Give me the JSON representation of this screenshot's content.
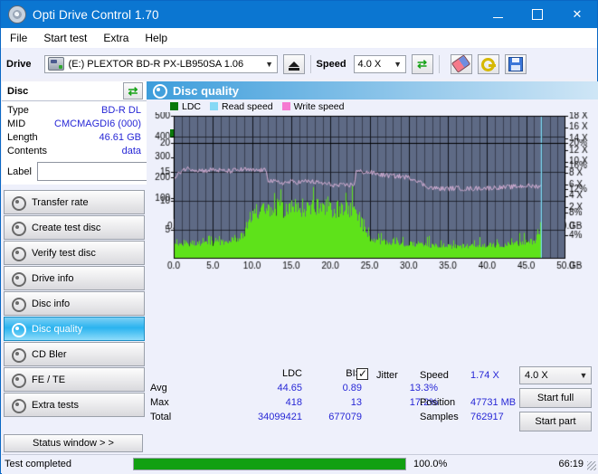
{
  "window": {
    "title": "Opti Drive Control 1.70",
    "icon": "disc-icon",
    "minimize": "–",
    "maximize": "□",
    "close": "✕"
  },
  "menu": {
    "items": [
      "File",
      "Start test",
      "Extra",
      "Help"
    ]
  },
  "drivebar": {
    "drive_label": "Drive",
    "drive_value": "(E:)   PLEXTOR BD-R  PX-LB950SA 1.06",
    "eject_icon": "eject-icon",
    "speed_label": "Speed",
    "speed_value": "4.0 X",
    "refresh_icon": "refresh-icon",
    "erase_icon": "eraser-icon",
    "key_icon": "key-icon",
    "save_icon": "floppy-save-icon"
  },
  "disc": {
    "header": "Disc",
    "refresh_icon": "refresh-icon",
    "fields": [
      {
        "label": "Type",
        "value": "BD-R DL"
      },
      {
        "label": "MID",
        "value": "CMCMAGDI6 (000)"
      },
      {
        "label": "Length",
        "value": "46.61 GB"
      },
      {
        "label": "Contents",
        "value": "data"
      }
    ],
    "label_field_label": "Label",
    "label_field_value": "",
    "label_icon": "cd-icon"
  },
  "nav": {
    "items": [
      {
        "label": "Transfer rate",
        "icon": "disc-icon",
        "active": false
      },
      {
        "label": "Create test disc",
        "icon": "disc-icon",
        "active": false
      },
      {
        "label": "Verify test disc",
        "icon": "disc-icon",
        "active": false
      },
      {
        "label": "Drive info",
        "icon": "disc-icon",
        "active": false
      },
      {
        "label": "Disc info",
        "icon": "disc-icon",
        "active": false
      },
      {
        "label": "Disc quality",
        "icon": "disc-icon",
        "active": true
      },
      {
        "label": "CD Bler",
        "icon": "disc-icon",
        "active": false
      },
      {
        "label": "FE / TE",
        "icon": "disc-icon",
        "active": false
      },
      {
        "label": "Extra tests",
        "icon": "disc-icon",
        "active": false
      }
    ],
    "status_window_button": "Status window > >"
  },
  "panel": {
    "title": "Disc quality",
    "icon": "disc-icon"
  },
  "stats": {
    "col_headers": [
      "LDC",
      "BIS"
    ],
    "rows": [
      {
        "label": "Avg",
        "ldc": "44.65",
        "bis": "0.89",
        "jitter": "13.3%"
      },
      {
        "label": "Max",
        "ldc": "418",
        "bis": "13",
        "jitter": "17.2%"
      },
      {
        "label": "Total",
        "ldc": "34099421",
        "bis": "677079",
        "jitter": ""
      }
    ],
    "jitter_label": "Jitter",
    "jitter_checked": true,
    "speed_label": "Speed",
    "speed_value": "1.74 X",
    "position_label": "Position",
    "position_value": "47731 MB",
    "samples_label": "Samples",
    "samples_value": "762917",
    "speed_select": "4.0 X",
    "start_full_button": "Start full",
    "start_part_button": "Start part"
  },
  "statusbar": {
    "message": "Test completed",
    "progress_percent": "100.0%",
    "progress_value": 100,
    "elapsed": "66:19"
  },
  "colors": {
    "title_bar": "#0b76d1",
    "plot_bg": "#5e6a85",
    "ldc_green": "#1fd81f",
    "bis_green": "#1fd81f",
    "read_speed": "#86d9f5",
    "write_speed": "#f57ad1",
    "jitter_pink": "#e0b6dd",
    "value_blue": "#2727d6",
    "progress_green": "#12a012"
  },
  "chart_data": [
    {
      "type": "area",
      "name": "ldc-chart",
      "title": "",
      "legend": [
        {
          "label": "LDC",
          "color": "#0a7a0a"
        },
        {
          "label": "Read speed",
          "color": "#86d9f5"
        },
        {
          "label": "Write speed",
          "color": "#f57ad1"
        }
      ],
      "legend_position": "top-left",
      "xlabel": "GB",
      "ylabel": "",
      "xlim": [
        0,
        50
      ],
      "ylim": [
        0,
        500
      ],
      "y2lim": [
        0,
        18
      ],
      "y2label": "X",
      "xticks": [
        "0.0",
        "5.0",
        "10.0",
        "15.0",
        "20.0",
        "25.0",
        "30.0",
        "35.0",
        "40.0",
        "45.0",
        "50.0"
      ],
      "yticks": [
        100,
        200,
        300,
        400,
        500
      ],
      "y2ticks": [
        "2 X",
        "4 X",
        "6 X",
        "8 X",
        "10 X",
        "12 X",
        "14 X",
        "16 X",
        "18 X"
      ],
      "grid": true,
      "data_end_gb": 46.9,
      "series": [
        {
          "name": "LDC",
          "kind": "area-spikes",
          "color": "#1fd81f",
          "x": [
            0,
            1,
            2,
            3,
            4,
            5,
            6,
            7,
            8,
            9,
            10,
            11,
            12,
            13,
            14,
            15,
            16,
            17,
            18,
            19,
            20,
            21,
            22,
            23,
            24,
            25,
            26,
            27,
            28,
            29,
            30,
            31,
            32,
            33,
            34,
            35,
            36,
            37,
            38,
            39,
            40,
            41,
            42,
            43,
            44,
            45,
            46,
            46.9
          ],
          "values": [
            30,
            35,
            38,
            42,
            45,
            52,
            58,
            66,
            74,
            84,
            96,
            112,
            125,
            140,
            152,
            162,
            170,
            176,
            180,
            182,
            183,
            184,
            186,
            188,
            196,
            175,
            120,
            70,
            48,
            42,
            40,
            36,
            34,
            32,
            32,
            30,
            30,
            30,
            28,
            28,
            28,
            27,
            27,
            26,
            26,
            26,
            30,
            46
          ],
          "peaks": [
            100,
            120,
            150,
            200,
            165,
            185,
            215,
            150,
            145,
            140,
            175,
            210,
            200,
            230,
            255,
            300,
            230,
            415,
            250,
            260,
            245,
            230,
            265,
            320,
            315,
            280,
            255,
            310,
            220,
            190,
            300,
            185,
            170,
            155,
            140,
            150,
            145,
            135,
            160,
            240,
            150,
            135,
            130,
            140,
            150,
            175,
            205,
            60
          ]
        },
        {
          "name": "Read speed",
          "kind": "line",
          "color": "#9fe2f7",
          "axis": "y2",
          "x": [
            0,
            1,
            2,
            3,
            4,
            5,
            6,
            7,
            8,
            9,
            10,
            11,
            12,
            13,
            14,
            15,
            16,
            17,
            18,
            19,
            20,
            21,
            22,
            23,
            23.5,
            24,
            25,
            26,
            27,
            28,
            29,
            30,
            31,
            32,
            33,
            34,
            35,
            36,
            37,
            38,
            39,
            40,
            41,
            42,
            43,
            44,
            45,
            46,
            46.9
          ],
          "values": [
            1.7,
            1.75,
            1.85,
            1.95,
            2.05,
            2.15,
            2.3,
            2.45,
            2.6,
            2.75,
            2.9,
            3.0,
            3.1,
            3.2,
            3.3,
            3.4,
            3.5,
            3.6,
            3.7,
            3.8,
            3.9,
            4.0,
            4.1,
            4.2,
            4.15,
            4.1,
            4.1,
            4.05,
            4.0,
            3.95,
            3.9,
            3.85,
            3.78,
            3.7,
            3.62,
            3.55,
            3.45,
            3.35,
            3.25,
            3.15,
            3.05,
            2.95,
            2.85,
            2.72,
            2.6,
            2.45,
            2.3,
            2.1,
            1.95
          ]
        }
      ],
      "cursor_gb": 46.9
    },
    {
      "type": "area",
      "name": "bis-jitter-chart",
      "title": "",
      "legend": [
        {
          "label": "BIS",
          "color": "#0a7a0a"
        },
        {
          "label": "Jitter",
          "color": "#e0b6dd"
        }
      ],
      "legend_position": "top-left",
      "xlabel": "GB",
      "ylabel": "",
      "xlim": [
        0,
        50
      ],
      "ylim": [
        0,
        20
      ],
      "y2lim": [
        0,
        20
      ],
      "y2label": "%",
      "xticks": [
        "0.0",
        "5.0",
        "10.0",
        "15.0",
        "20.0",
        "25.0",
        "30.0",
        "35.0",
        "40.0",
        "45.0",
        "50.0"
      ],
      "yticks": [
        5,
        10,
        15,
        20
      ],
      "y2ticks": [
        "4%",
        "8%",
        "12%",
        "16%",
        "20%"
      ],
      "grid": true,
      "data_end_gb": 46.9,
      "series": [
        {
          "name": "BIS",
          "kind": "area-spikes",
          "color": "#5ee21a",
          "x": [
            0,
            1,
            2,
            3,
            4,
            5,
            6,
            7,
            8,
            9,
            10,
            11,
            12,
            13,
            14,
            15,
            16,
            17,
            18,
            19,
            20,
            21,
            22,
            23,
            24,
            25,
            26,
            27,
            28,
            29,
            30,
            31,
            32,
            33,
            34,
            35,
            36,
            37,
            38,
            39,
            40,
            41,
            42,
            43,
            44,
            45,
            46,
            46.9
          ],
          "values": [
            2.6,
            2.6,
            2.6,
            2.6,
            2.7,
            2.7,
            2.8,
            3.0,
            3.4,
            4.6,
            7.9,
            8.0,
            8.2,
            8.5,
            8.6,
            8.6,
            8.6,
            8.8,
            8.7,
            8.6,
            8.5,
            8.5,
            8.4,
            8.5,
            6.0,
            3.2,
            3.0,
            2.9,
            2.8,
            2.6,
            2.5,
            2.4,
            2.3,
            2.2,
            2.2,
            2.1,
            2.1,
            2.2,
            2.2,
            2.2,
            2.3,
            2.3,
            2.4,
            2.5,
            2.6,
            2.8,
            3.0,
            5.9
          ],
          "peaks": [
            3.4,
            3.6,
            3.8,
            4.2,
            4.4,
            4.6,
            4.8,
            5.6,
            6.6,
            7.0,
            9.6,
            9.9,
            10.6,
            11.6,
            12.0,
            11.0,
            10.6,
            11.8,
            10.4,
            11.0,
            10.6,
            10.4,
            10.0,
            12.6,
            9.2,
            5.4,
            6.4,
            5.2,
            4.6,
            4.4,
            8.2,
            5.0,
            4.2,
            4.0,
            3.8,
            4.0,
            3.8,
            4.0,
            4.2,
            4.4,
            4.6,
            4.2,
            4.4,
            4.6,
            4.8,
            5.2,
            5.6,
            6.0
          ]
        },
        {
          "name": "Jitter",
          "kind": "line",
          "color": "#e0b6dd",
          "axis": "y2",
          "x": [
            0,
            1,
            2,
            3,
            4,
            5,
            6,
            7,
            8,
            9,
            10,
            11,
            11.8,
            12,
            13,
            14,
            15,
            16,
            17,
            18,
            19,
            20,
            21,
            22,
            23,
            23.2,
            24,
            25,
            26,
            27,
            28,
            29,
            30,
            31,
            32,
            33,
            34,
            35,
            36,
            37,
            38,
            39,
            40,
            41,
            42,
            43,
            44,
            45,
            46,
            46.9
          ],
          "values": [
            13.6,
            15.4,
            15.6,
            15.3,
            15.2,
            15.4,
            15.2,
            15.1,
            15.3,
            15.4,
            15.2,
            15.3,
            15.2,
            13.6,
            13.2,
            13.1,
            13.3,
            13.2,
            13.4,
            13.2,
            13.0,
            12.8,
            12.6,
            12.7,
            12.8,
            15.1,
            15.0,
            14.9,
            14.6,
            14.4,
            14.3,
            14.2,
            14.0,
            13.6,
            12.6,
            12.2,
            12.1,
            12.1,
            12.2,
            12.1,
            12.1,
            12.2,
            12.2,
            12.3,
            12.3,
            12.4,
            12.5,
            12.6,
            12.5,
            12.6
          ]
        }
      ],
      "cursor_gb": 46.9
    }
  ]
}
